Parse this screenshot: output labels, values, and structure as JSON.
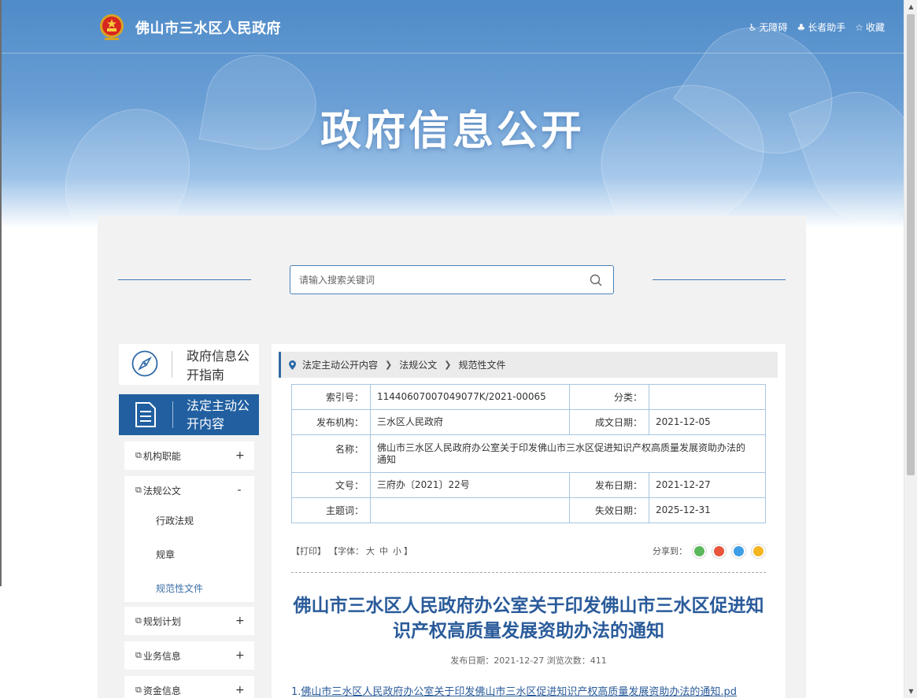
{
  "header": {
    "site_name": "佛山市三水区人民政府",
    "tools": [
      {
        "label": "无障碍",
        "icon": "accessibility-icon"
      },
      {
        "label": "长者助手",
        "icon": "elder-helper-icon"
      },
      {
        "label": "收藏",
        "icon": "star-icon"
      }
    ],
    "banner_title": "政府信息公开"
  },
  "search": {
    "placeholder": "请输入搜索关键词"
  },
  "sidebar": {
    "guide_label": "政府信息公开指南",
    "active_label": "法定主动公开内容",
    "items": [
      {
        "label": "机构职能",
        "toggle": "+"
      },
      {
        "label": "法规公文",
        "toggle": "-",
        "children": [
          "行政法规",
          "规章",
          "规范性文件"
        ]
      },
      {
        "label": "规划计划",
        "toggle": "+"
      },
      {
        "label": "业务信息",
        "toggle": "+"
      },
      {
        "label": "资金信息",
        "toggle": "+"
      }
    ],
    "current_child": "规范性文件"
  },
  "breadcrumb": [
    "法定主动公开内容",
    "法规公文",
    "规范性文件"
  ],
  "meta": {
    "index_no_label": "索引号：",
    "index_no": "11440607007049077K/2021-00065",
    "category_label": "分类：",
    "category": "",
    "publisher_label": "发布机构：",
    "publisher": "三水区人民政府",
    "created_label": "成文日期：",
    "created": "2021-12-05",
    "name_label": "名称：",
    "name": "佛山市三水区人民政府办公室关于印发佛山市三水区促进知识产权高质量发展资助办法的通知",
    "doc_no_label": "文号：",
    "doc_no": "三府办〔2021〕22号",
    "published_label": "发布日期：",
    "published": "2021-12-27",
    "subject_label": "主题词：",
    "subject": "",
    "expiry_label": "失效日期：",
    "expiry": "2025-12-31"
  },
  "toolbar": {
    "print": "【打印】",
    "font_prefix": "【字体：",
    "size_large": "大",
    "size_medium": "中",
    "size_small": "小",
    "font_suffix": "】",
    "share_label": "分享到：",
    "share_icons": [
      "wechat-share-icon",
      "weibo-share-icon",
      "qq-share-icon",
      "qzone-share-icon"
    ]
  },
  "article": {
    "title": "佛山市三水区人民政府办公室关于印发佛山市三水区促进知识产权高质量发展资助办法的通知",
    "pub_info": "发布日期：2021-12-27  浏览次数：411",
    "attachment_prefix": "1.",
    "attachment_link": "佛山市三水区人民政府办公室关于印发佛山市三水区促进知识产权高质量发展资助办法的通知.pd"
  },
  "colors": {
    "accent": "#215fa0",
    "title": "#2a5b9a",
    "table_border": "#a8c5e0"
  }
}
